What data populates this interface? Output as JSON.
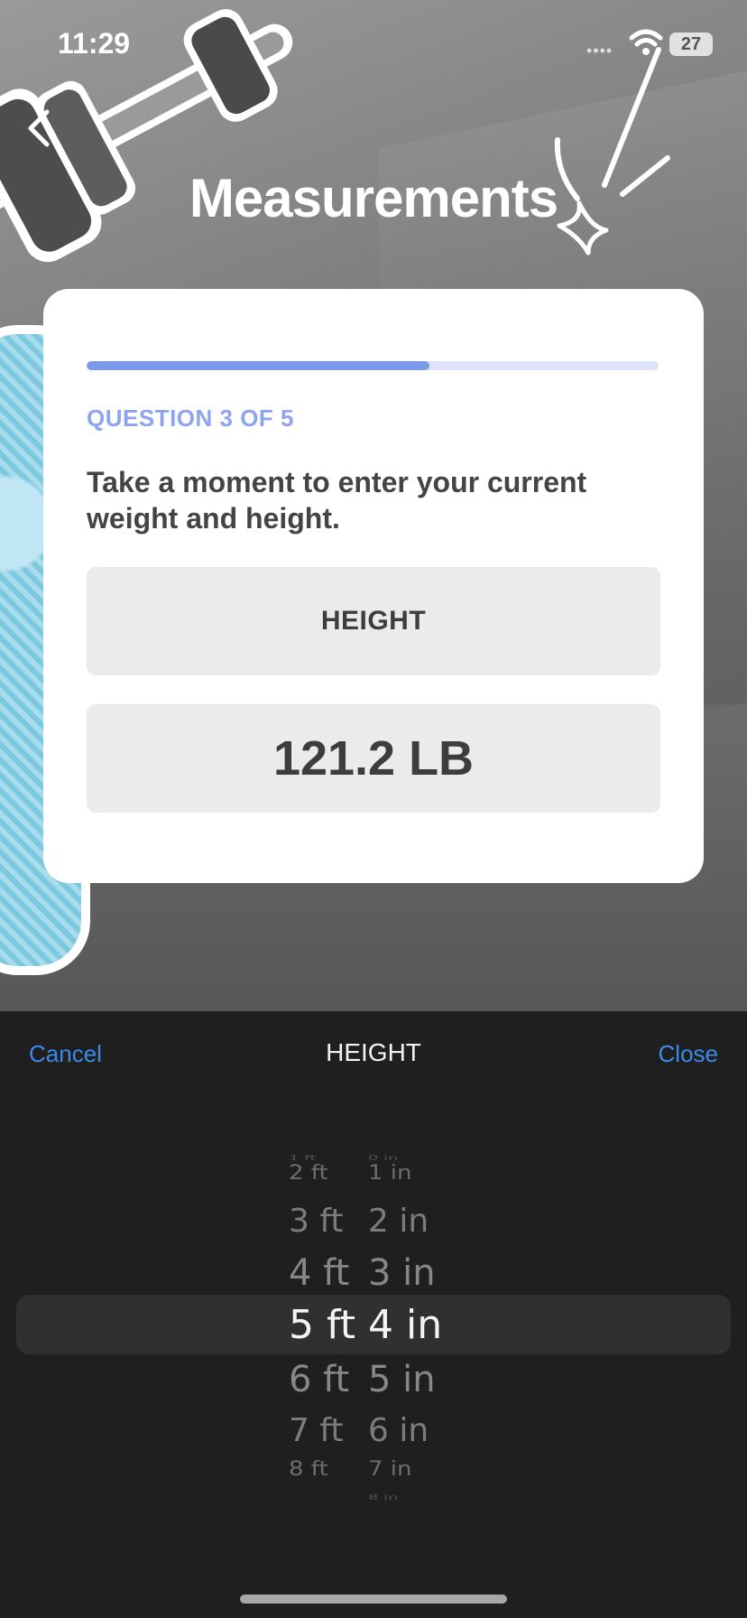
{
  "status_bar": {
    "time": "11:29",
    "battery": "27"
  },
  "header": {
    "title": "Measurements"
  },
  "card": {
    "progress_fraction": 0.6,
    "question_count": "QUESTION 3 OF 5",
    "prompt": "Take a moment to enter your current weight and height.",
    "height_field": "HEIGHT",
    "weight_field": "121.2 LB"
  },
  "sheet": {
    "cancel_label": "Cancel",
    "title": "HEIGHT",
    "close_label": "Close",
    "feet_options": [
      "1 ft",
      "2 ft",
      "3 ft",
      "4 ft",
      "5 ft",
      "6 ft",
      "7 ft",
      "8 ft"
    ],
    "inch_options": [
      "0 in",
      "1 in",
      "2 in",
      "3 in",
      "4 in",
      "5 in",
      "6 in",
      "7 in",
      "8 in"
    ],
    "selected_feet": "5 ft",
    "selected_inches": "4 in"
  },
  "icons": {
    "back": "chevron-left-icon",
    "wifi": "wifi-icon",
    "battery": "battery-icon",
    "sparkle": "sparkle-doodle-icon"
  },
  "colors": {
    "accent": "#7f99ea",
    "link": "#3b8ae8",
    "sheet_bg": "#1f1f20"
  }
}
